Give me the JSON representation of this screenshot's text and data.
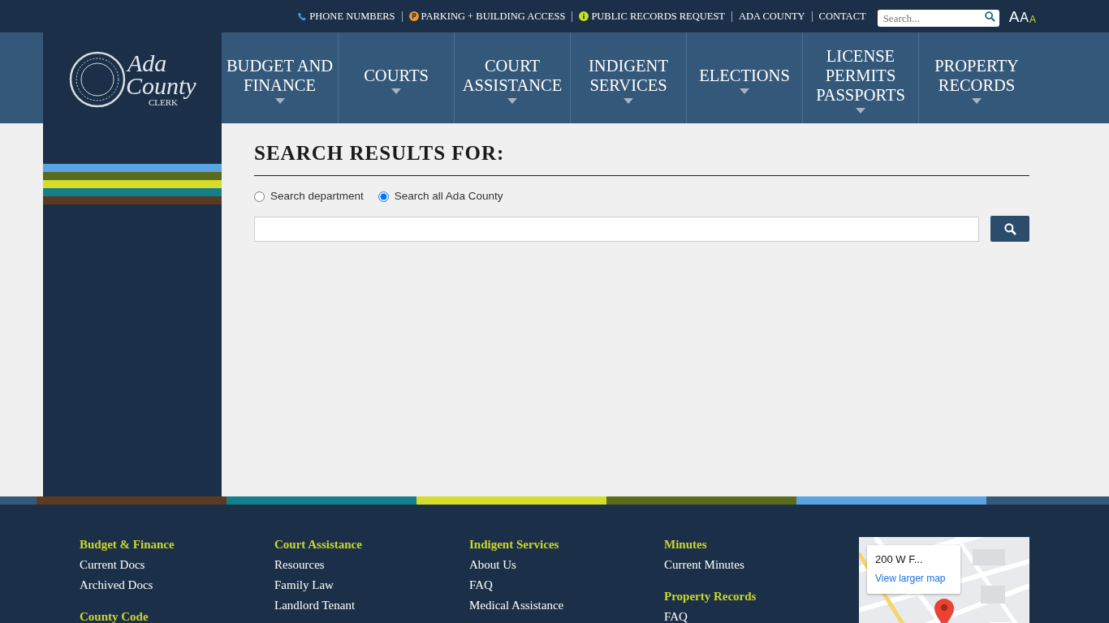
{
  "utility_links": [
    {
      "label": "PHONE NUMBERS",
      "kind": "phone"
    },
    {
      "label": "PARKING + BUILDING ACCESS",
      "kind": "parking"
    },
    {
      "label": "PUBLIC RECORDS REQUEST",
      "kind": "info"
    },
    {
      "label": "ADA COUNTY",
      "kind": "plain"
    },
    {
      "label": "CONTACT",
      "kind": "plain"
    }
  ],
  "site_search": {
    "placeholder": "Search..."
  },
  "font_sizes": [
    {
      "label": "A",
      "kind": "large",
      "selected": false
    },
    {
      "label": "A",
      "kind": "medium",
      "selected": false
    },
    {
      "label": "A",
      "kind": "small",
      "selected": true
    }
  ],
  "logo": {
    "script_top": "Ada",
    "script_bottom": "County",
    "subtitle": "CLERK"
  },
  "nav_items": [
    {
      "label": "BUDGET AND\nFINANCE"
    },
    {
      "label": "COURTS"
    },
    {
      "label": "COURT\nASSISTANCE"
    },
    {
      "label": "INDIGENT\nSERVICES"
    },
    {
      "label": "ELECTIONS"
    },
    {
      "label": "LICENSE\nPERMITS\nPASSPORTS"
    },
    {
      "label": "PROPERTY\nRECORDS"
    }
  ],
  "sidebar_stripes": [
    {
      "color": "#5ba4e3"
    },
    {
      "color": "#5a6b1b"
    },
    {
      "color": "#d5dc2b"
    },
    {
      "color": "#137f8a"
    },
    {
      "color": "#5c3a22"
    }
  ],
  "search_results": {
    "heading": "SEARCH RESULTS FOR:",
    "scopes": [
      {
        "label": "Search department",
        "selected": false
      },
      {
        "label": "Search all Ada County",
        "selected": true
      }
    ]
  },
  "footer_stripes": [
    {
      "color": "#34587a"
    },
    {
      "color": "#5c3a22"
    },
    {
      "color": "#137f8a"
    },
    {
      "color": "#d5dc2b"
    },
    {
      "color": "#5a6b1b"
    },
    {
      "color": "#5ba4e3"
    },
    {
      "color": "#34587a"
    }
  ],
  "footer_columns": [
    {
      "groups": [
        {
          "heading": "Budget & Finance",
          "links": [
            "Current Docs",
            "Archived Docs"
          ]
        },
        {
          "heading": "County Code"
        }
      ]
    },
    {
      "groups": [
        {
          "heading": "Court Assistance",
          "links": [
            "Resources",
            "Family Law",
            "Landlord Tenant"
          ]
        }
      ]
    },
    {
      "groups": [
        {
          "heading": "Indigent Services",
          "links": [
            "About Us",
            "FAQ",
            "Medical Assistance"
          ]
        }
      ]
    },
    {
      "groups": [
        {
          "heading": "Minutes",
          "links": [
            "Current Minutes"
          ]
        },
        {
          "heading": "Property Records",
          "links": [
            "FAQ"
          ]
        }
      ]
    }
  ],
  "map": {
    "kind": "picture",
    "place_title": "200 W F...",
    "link": "View larger map"
  }
}
